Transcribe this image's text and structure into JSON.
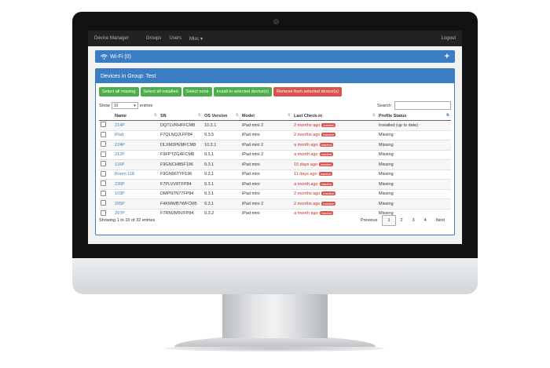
{
  "navbar": {
    "brand": "Device Manager",
    "items": [
      "Groups",
      "Users",
      "Misc ▾"
    ],
    "logout": "Logout"
  },
  "wifi_panel": {
    "title": "Wi-Fi (0)",
    "add_icon": "plus-icon"
  },
  "devices_panel": {
    "title": "Devices in Group: Test",
    "buttons": {
      "select_all_missing": "Select all missing",
      "select_all_installed": "Select all installed",
      "select_none": "Select none",
      "install": "Install to selected device(s)",
      "remove": "Remove from selected device(s)"
    },
    "show_label": "Show",
    "page_size": "10",
    "entries_label": "entries",
    "search_label": "Search:",
    "columns": [
      "Name",
      "SN",
      "OS Version",
      "Model",
      "Last Check-in",
      "Profile Status"
    ],
    "inactive_label": "Inactive",
    "rows": [
      {
        "name": "214P",
        "sn": "DQTLVRHFFCM8",
        "os": "10.2.1",
        "model": "iPad mini 2",
        "checkin": "2 months ago",
        "status": "Installed (up to date)"
      },
      {
        "name": "iPad",
        "sn": "F7QLNQJLFP84",
        "os": "9.3.5",
        "model": "iPad mini",
        "checkin": "2 months ago",
        "status": "Missing"
      },
      {
        "name": "224P",
        "sn": "DLXM3PEMFCM8",
        "os": "10.3.1",
        "model": "iPad mini 2",
        "checkin": "a month ago",
        "status": "Missing"
      },
      {
        "name": "212P",
        "sn": "F9FPTZGAFCM8",
        "os": "9.3.1",
        "model": "iPad mini 2",
        "checkin": "a month ago",
        "status": "Missing"
      },
      {
        "name": "116P",
        "sn": "F9GNCHB5F196",
        "os": "9.3.1",
        "model": "iPad mini",
        "checkin": "15 days ago",
        "status": "Missing"
      },
      {
        "name": "Room 118",
        "sn": "F9GN96TYF196",
        "os": "9.3.1",
        "model": "iPad mini",
        "checkin": "11 days ago",
        "status": "Missing"
      },
      {
        "name": "230P",
        "sn": "F7PLVV8TFP84",
        "os": "9.3.1",
        "model": "iPad mini",
        "checkin": "a month ago",
        "status": "Missing"
      },
      {
        "name": "103P",
        "sn": "DMPN7N77FP84",
        "os": "9.3.1",
        "model": "iPad mini",
        "checkin": "2 months ago",
        "status": "Missing"
      },
      {
        "name": "205P",
        "sn": "F4KMWB7WFCM5",
        "os": "9.3.1",
        "model": "iPad mini 2",
        "checkin": "2 months ago",
        "status": "Missing"
      },
      {
        "name": "207P",
        "sn": "F7RM2M5VFP84",
        "os": "9.3.2",
        "model": "iPad mini",
        "checkin": "a month ago",
        "status": "Missing"
      }
    ],
    "info": "Showing 1 to 10 of 32 entries",
    "pagination": [
      "Previous",
      "1",
      "2",
      "3",
      "4",
      "Next"
    ],
    "current_page": "1"
  },
  "colors": {
    "primary": "#3b7dc2",
    "success": "#4cae4c",
    "danger": "#d9534f",
    "navbar": "#222222"
  }
}
